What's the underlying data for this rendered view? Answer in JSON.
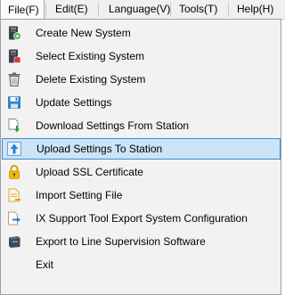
{
  "menubar": {
    "file": "File(F)",
    "edit": "Edit(E)",
    "language": "Language(V)",
    "tools": "Tools(T)",
    "help": "Help(H)"
  },
  "file_menu": {
    "create": "Create New System",
    "select": "Select Existing System",
    "delete": "Delete Existing System",
    "update": "Update Settings",
    "download": "Download Settings From Station",
    "upload": "Upload Settings To Station",
    "ssl": "Upload SSL Certificate",
    "import": "Import Setting File",
    "ix_export": "IX Support Tool Export System Configuration",
    "line_export": "Export to Line Supervision Software",
    "exit": "Exit"
  },
  "colors": {
    "highlight_bg": "#cce4f7",
    "highlight_border": "#3b8bd1",
    "menu_bg": "#f2f2f2"
  }
}
